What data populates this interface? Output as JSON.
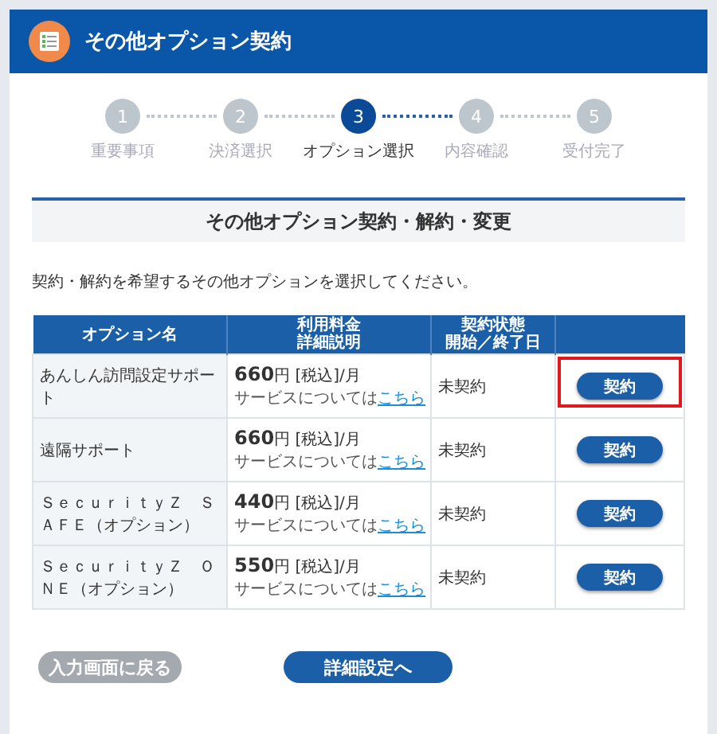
{
  "header": {
    "title": "その他オプション契約"
  },
  "steps": [
    {
      "number": "1",
      "label": "重要事項",
      "selected": false
    },
    {
      "number": "2",
      "label": "決済選択",
      "selected": false
    },
    {
      "number": "3",
      "label": "オプション選択",
      "selected": true
    },
    {
      "number": "4",
      "label": "内容確認",
      "selected": false
    },
    {
      "number": "5",
      "label": "受付完了",
      "selected": false
    }
  ],
  "section_title": "その他オプション契約・解約・変更",
  "instruction": "契約・解約を希望するその他オプションを選択してください。",
  "table": {
    "columns": [
      {
        "lines": [
          "オプション名"
        ]
      },
      {
        "lines": [
          "利用料金",
          "詳細説明"
        ]
      },
      {
        "lines": [
          "契約状態",
          "開始／終了日"
        ]
      }
    ],
    "rows": [
      {
        "name": "あんしん訪問設定サポート",
        "price": "**660**円 [税込]/月",
        "note": "サービスについては",
        "link": "こちら",
        "status": "未契約",
        "action": "契約",
        "highlighted": true
      },
      {
        "name": "遠隔サポート",
        "price": "**660**円 [税込]/月",
        "note": "サービスについては",
        "link": "こちら",
        "status": "未契約",
        "action": "契約",
        "highlighted": false
      },
      {
        "name": "ＳｅｃｕｒｉｔｙＺ　ＳＡＦＥ（オプション）",
        "price": "**440**円 [税込]/月",
        "note": "サービスについては",
        "link": "こちら",
        "status": "未契約",
        "action": "契約",
        "highlighted": false
      },
      {
        "name": "ＳｅｃｕｒｉｔｙＺ　ＯＮＥ（オプション）",
        "price": "**550**円 [税込]/月",
        "note": "サービスについては",
        "link": "こちら",
        "status": "未契約",
        "action": "契約",
        "highlighted": false
      }
    ]
  },
  "buttons": [
    {
      "label": "入力画面に戻る",
      "kind": "secondary"
    },
    {
      "label": "詳細設定へ",
      "kind": "primary"
    }
  ]
}
